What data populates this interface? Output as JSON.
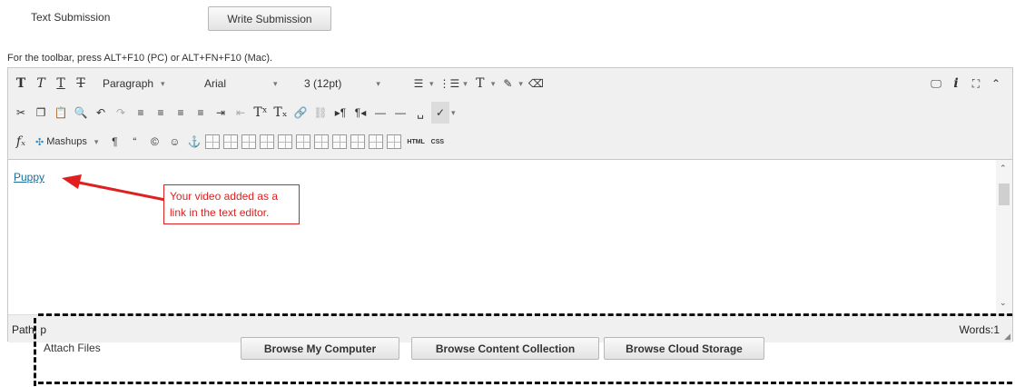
{
  "text_submission": {
    "label": "Text Submission",
    "write_button": "Write Submission"
  },
  "toolbar_hint": "For the toolbar, press ALT+F10 (PC) or ALT+FN+F10 (Mac).",
  "toolbar": {
    "paragraph": "Paragraph",
    "font": "Arial",
    "size": "3 (12pt)",
    "mashups": "Mashups",
    "html": "HTML",
    "css": "CSS"
  },
  "editor": {
    "link_text": "Puppy",
    "path_label": "Path: p",
    "words": "Words:1"
  },
  "callout": {
    "line1": "Your video added as a",
    "line2": "link in the text editor."
  },
  "attach": {
    "label": "Attach Files",
    "browse_computer": "Browse My Computer",
    "browse_collection": "Browse Content Collection",
    "browse_cloud": "Browse Cloud Storage"
  },
  "colors": {
    "callout": "#e02020",
    "link": "#1a6e99"
  }
}
